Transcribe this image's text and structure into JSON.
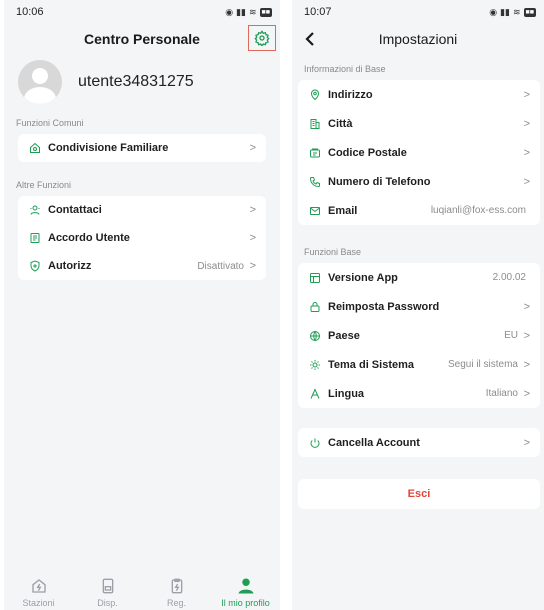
{
  "left": {
    "time": "10:06",
    "title": "Centro Personale",
    "username": "utente34831275",
    "sections": [
      {
        "label": "Funzioni Comuni",
        "items": [
          {
            "label": "Condivisione Familiare",
            "value": "",
            "icon": "share-icon"
          }
        ]
      },
      {
        "label": "Altre Funzioni",
        "items": [
          {
            "label": "Contattaci",
            "value": "",
            "icon": "support-icon"
          },
          {
            "label": "Accordo Utente",
            "value": "",
            "icon": "document-icon"
          },
          {
            "label": "Autorizz",
            "value": "Disattivato",
            "icon": "shield-icon"
          }
        ]
      }
    ],
    "tabs": [
      {
        "label": "Stazioni",
        "icon": "station-icon"
      },
      {
        "label": "Disp.",
        "icon": "device-icon"
      },
      {
        "label": "Reg.",
        "icon": "record-icon"
      },
      {
        "label": "Il mio profilo",
        "icon": "profile-icon"
      }
    ]
  },
  "right": {
    "time": "10:07",
    "title": "Impostazioni",
    "sections": [
      {
        "label": "Informazioni di Base",
        "items": [
          {
            "label": "Indirizzo",
            "value": "",
            "icon": "location-icon"
          },
          {
            "label": "Città",
            "value": "",
            "icon": "city-icon"
          },
          {
            "label": "Codice Postale",
            "value": "",
            "icon": "postal-icon"
          },
          {
            "label": "Numero di Telefono",
            "value": "",
            "icon": "phone-icon"
          },
          {
            "label": "Email",
            "value": "luqianli@fox-ess.com",
            "icon": "email-icon"
          }
        ]
      },
      {
        "label": "Funzioni Base",
        "items": [
          {
            "label": "Versione App",
            "value": "2.00.02",
            "icon": "app-version-icon"
          },
          {
            "label": "Reimposta Password",
            "value": "",
            "icon": "lock-icon"
          },
          {
            "label": "Paese",
            "value": "EU",
            "icon": "globe-icon"
          },
          {
            "label": "Tema di Sistema",
            "value": "Segui il sistema",
            "icon": "theme-icon"
          },
          {
            "label": "Lingua",
            "value": "Italiano",
            "icon": "language-icon"
          }
        ]
      }
    ],
    "cancel_account": "Cancella Account",
    "logout": "Esci"
  },
  "colors": {
    "accent": "#1f9d55",
    "danger": "#e0473a",
    "highlight": "#e06a5a"
  },
  "chevron": ">"
}
